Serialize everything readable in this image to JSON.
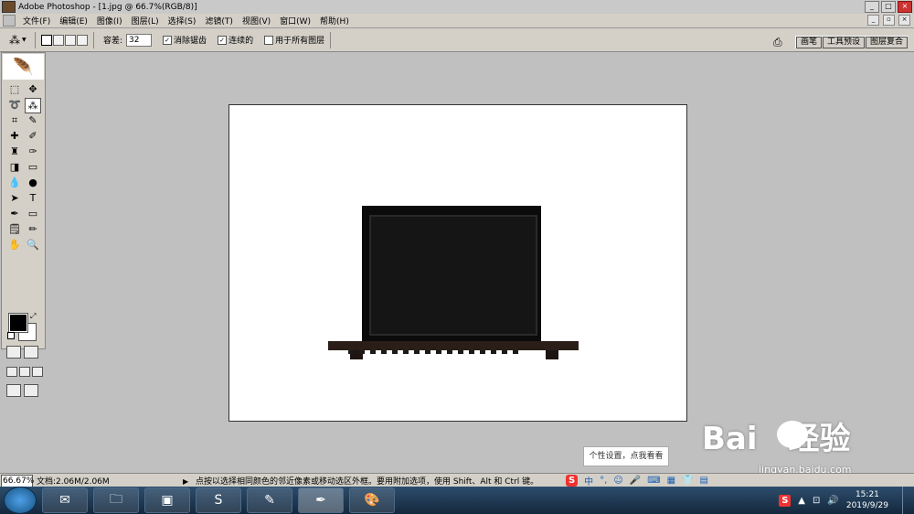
{
  "window": {
    "title": "Adobe Photoshop - [1.jpg @ 66.7%(RGB/8)]"
  },
  "menubar": {
    "items": [
      "文件(F)",
      "编辑(E)",
      "图像(I)",
      "图层(L)",
      "选择(S)",
      "滤镜(T)",
      "视图(V)",
      "窗口(W)",
      "帮助(H)"
    ]
  },
  "options": {
    "tolerance_label": "容差:",
    "tolerance_value": "32",
    "antialias_label": "消除锯齿",
    "antialias_checked": true,
    "contiguous_label": "连续的",
    "contiguous_checked": true,
    "sample_all_label": "用于所有图层",
    "sample_all_checked": false,
    "palette_wells": [
      "画笔",
      "工具预设",
      "图层复合"
    ]
  },
  "tooltip": {
    "text": "个性设置，点我看看"
  },
  "status": {
    "zoom": "66.67%",
    "doc_size": "文档:2.06M/2.06M",
    "hint": "点按以选择相同颜色的邻近像素或移动选区外框。要用附加选项，使用 Shift、Alt 和 Ctrl 键。"
  },
  "ime": {
    "mode": "中"
  },
  "watermark": {
    "brand": "Bai",
    "brand2": "经验",
    "url": "jingyan.baidu.com"
  },
  "taskbar": {
    "time": "15:21",
    "date": "2019/9/29"
  }
}
